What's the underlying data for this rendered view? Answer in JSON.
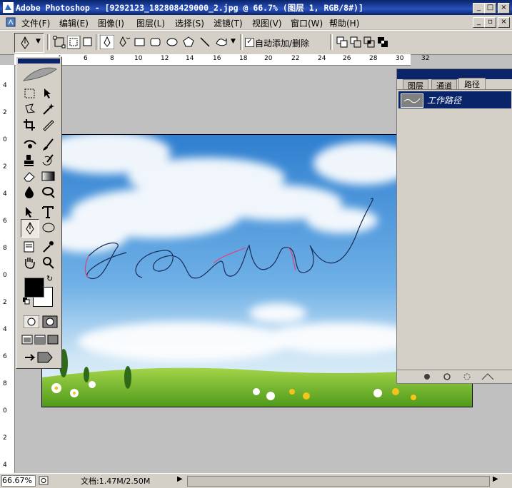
{
  "window": {
    "title": "Adobe Photoshop - [9292123_182808429000_2.jpg @ 66.7% (图层 1, RGB/8#)]",
    "controls": [
      "_",
      "□",
      "×"
    ]
  },
  "menu": {
    "items": [
      "文件(F)",
      "编辑(E)",
      "图像(I)",
      "图层(L)",
      "选择(S)",
      "滤镜(T)",
      "视图(V)",
      "窗口(W)",
      "帮助(H)"
    ]
  },
  "options": {
    "auto_add_delete_label": "自动添加/删除",
    "auto_add_delete_checked": true
  },
  "rulers": {
    "top": [
      "4",
      "6",
      "8",
      "10",
      "12",
      "14",
      "16",
      "18",
      "20",
      "22",
      "24",
      "26",
      "28",
      "30",
      "32"
    ],
    "left": [
      "4",
      "2",
      "0",
      "2",
      "4",
      "6",
      "8",
      "0",
      "2",
      "4",
      "6",
      "8",
      "0",
      "2",
      "4"
    ]
  },
  "panel": {
    "tabs": [
      "图层",
      "通道",
      "路径"
    ],
    "active_tab": "路径",
    "paths": [
      {
        "name": "工作路径",
        "selected": true
      }
    ]
  },
  "status": {
    "zoom": "66.67%",
    "doc": "文档:1.47M/2.50M"
  },
  "colors": {
    "title_bar": "#0a246a",
    "chrome": "#d4d0c8",
    "selection": "#0a246a",
    "path_stroke": "#1a2b5a",
    "anchor_highlight": "#e0407a"
  }
}
